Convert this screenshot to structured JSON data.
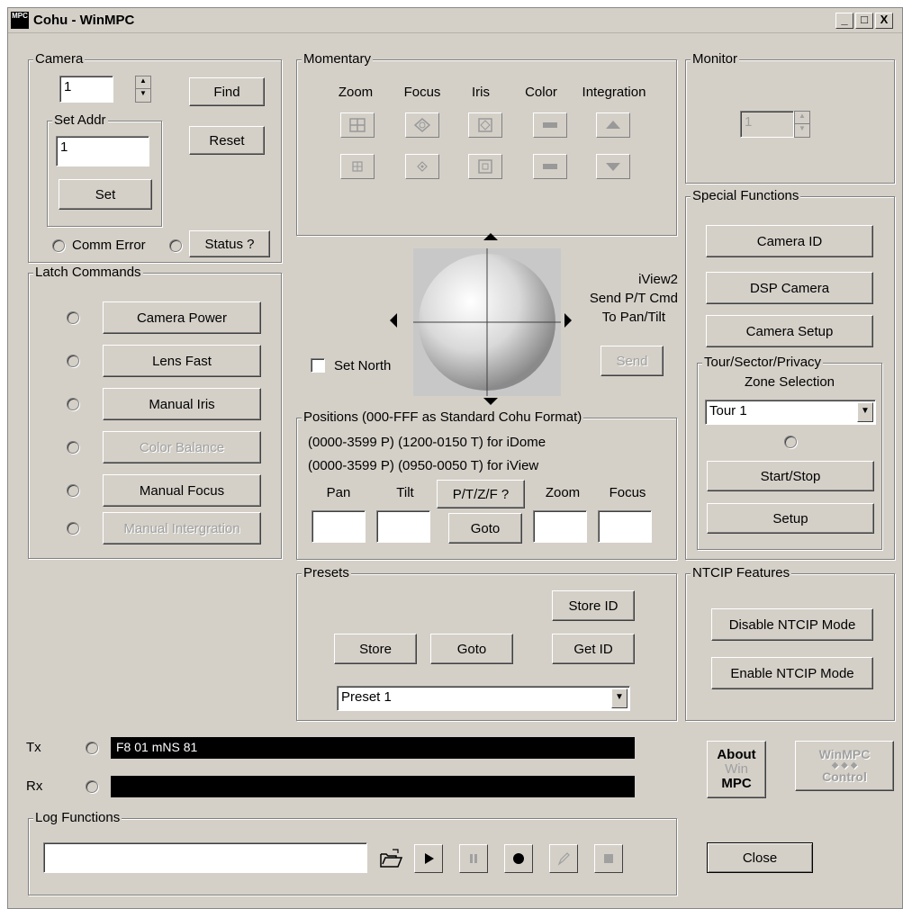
{
  "window": {
    "title": "Cohu - WinMPC",
    "icon_text": "MPC",
    "controls": [
      "_",
      "□",
      "X"
    ]
  },
  "camera": {
    "legend": "Camera",
    "address_value": "1",
    "find_label": "Find",
    "reset_label": "Reset",
    "set_addr_legend": "Set Addr",
    "set_addr_value": "1",
    "set_label": "Set",
    "comm_error_label": "Comm Error",
    "status_label": "Status ?"
  },
  "latch": {
    "legend": "Latch Commands",
    "items": [
      {
        "label": "Camera Power",
        "enabled": true
      },
      {
        "label": "Lens Fast",
        "enabled": true
      },
      {
        "label": "Manual Iris",
        "enabled": true
      },
      {
        "label": "Color Balance",
        "enabled": false
      },
      {
        "label": "Manual Focus",
        "enabled": true
      },
      {
        "label": "Manual Intergration",
        "enabled": false
      }
    ]
  },
  "momentary": {
    "legend": "Momentary",
    "columns": [
      "Zoom",
      "Focus",
      "Iris",
      "Color",
      "Integration"
    ]
  },
  "ptz": {
    "set_north_label": "Set North",
    "iview_line1": "iView2",
    "iview_line2": "Send P/T Cmd",
    "iview_line3": "To Pan/Tilt",
    "send_label": "Send"
  },
  "positions": {
    "legend": "Positions (000-FFF as Standard Cohu Format)",
    "line1": "(0000-3599  P)  (1200-0150  T) for iDome",
    "line2": "(0000-3599  P)  (0950-0050  T) for iView",
    "pan_label": "Pan",
    "tilt_label": "Tilt",
    "ptzf_label": "P/T/Z/F ?",
    "zoom_label": "Zoom",
    "focus_label": "Focus",
    "goto_label": "Goto"
  },
  "presets": {
    "legend": "Presets",
    "store_id_label": "Store ID",
    "store_label": "Store",
    "goto_label": "Goto",
    "get_id_label": "Get ID",
    "selected": "Preset 1"
  },
  "monitor": {
    "legend": "Monitor",
    "value": "1"
  },
  "special": {
    "legend": "Special Functions",
    "camera_id_label": "Camera ID",
    "dsp_camera_label": "DSP Camera",
    "camera_setup_label": "Camera Setup",
    "tour_legend": "Tour/Sector/Privacy",
    "zone_selection_label": "Zone Selection",
    "tour_selected": "Tour 1",
    "start_stop_label": "Start/Stop",
    "setup_label": "Setup"
  },
  "ntcip": {
    "legend": "NTCIP Features",
    "disable_label": "Disable NTCIP Mode",
    "enable_label": "Enable NTCIP Mode"
  },
  "comm": {
    "tx_label": "Tx",
    "tx_value": "F8 01 mNS 81",
    "rx_label": "Rx",
    "rx_value": ""
  },
  "log": {
    "legend": "Log Functions",
    "file_value": ""
  },
  "about": {
    "line1": "About",
    "line2": "Win",
    "line3": "MPC"
  },
  "winmpc_control": {
    "line1": "WinMPC",
    "line2": "Control"
  },
  "close_label": "Close"
}
